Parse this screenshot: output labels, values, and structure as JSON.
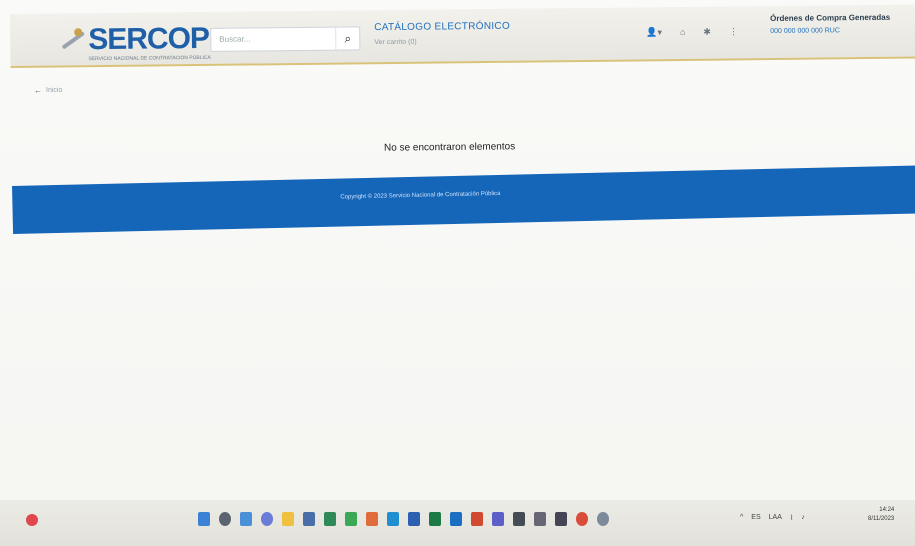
{
  "header": {
    "logo_text": "SERCOP",
    "logo_subtitle": "SERVICIO NACIONAL DE CONTRATACIÓN PÚBLICA",
    "search_placeholder": "Buscar...",
    "catalog_title": "CATÁLOGO ELECTRÓNICO",
    "catalog_subtitle": "Ver carrito (0)",
    "user_name": "Órdenes de Compra Generadas",
    "user_id": "000 000 000 000 RUC"
  },
  "breadcrumb": {
    "arrow": "←",
    "label": "Inicio"
  },
  "main": {
    "empty_message": "No se encontraron elementos"
  },
  "footer": {
    "copyright": "Copyright © 2023 Servicio Nacional de Contratación Pública"
  },
  "taskbar": {
    "tray_items": [
      "^",
      "ES",
      "LAA",
      "WiFi",
      "Vol"
    ],
    "time": "14:24",
    "date": "8/11/2023"
  },
  "colors": {
    "brand_blue": "#1f5fa8",
    "footer_blue": "#1566b9",
    "accent_gold": "#d9c27a"
  }
}
